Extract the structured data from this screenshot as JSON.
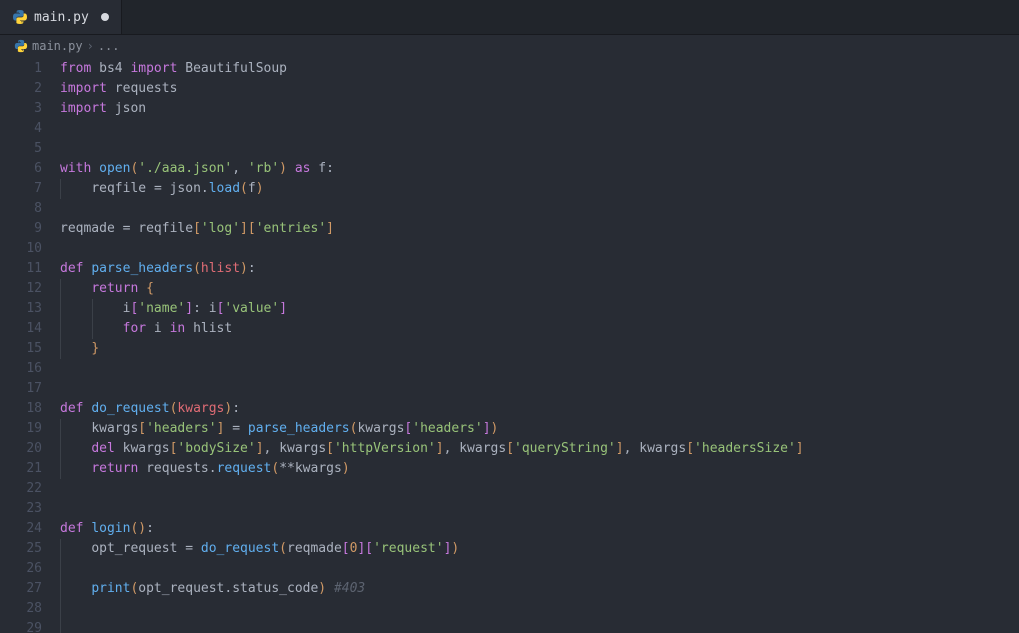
{
  "tab": {
    "filename": "main.py",
    "modified": true
  },
  "breadcrumb": {
    "filename": "main.py",
    "symbol": "..."
  },
  "line_count": 29,
  "code_lines": [
    {
      "n": 1,
      "indent": 0,
      "tokens": [
        [
          "kw",
          "from"
        ],
        [
          "pale",
          " bs4 "
        ],
        [
          "kw",
          "import"
        ],
        [
          "pale",
          " BeautifulSoup"
        ]
      ]
    },
    {
      "n": 2,
      "indent": 0,
      "tokens": [
        [
          "kw",
          "import"
        ],
        [
          "pale",
          " requests"
        ]
      ]
    },
    {
      "n": 3,
      "indent": 0,
      "tokens": [
        [
          "kw",
          "import"
        ],
        [
          "pale",
          " json"
        ]
      ]
    },
    {
      "n": 4,
      "indent": 0,
      "tokens": []
    },
    {
      "n": 5,
      "indent": 0,
      "tokens": []
    },
    {
      "n": 6,
      "indent": 0,
      "tokens": [
        [
          "kw",
          "with"
        ],
        [
          "pale",
          " "
        ],
        [
          "fn",
          "open"
        ],
        [
          "paren",
          "("
        ],
        [
          "str",
          "'./aaa.json'"
        ],
        [
          "pun",
          ", "
        ],
        [
          "str",
          "'rb'"
        ],
        [
          "paren",
          ")"
        ],
        [
          "pale",
          " "
        ],
        [
          "kw",
          "as"
        ],
        [
          "pale",
          " f"
        ],
        [
          "pun",
          ":"
        ]
      ]
    },
    {
      "n": 7,
      "indent": 1,
      "tokens": [
        [
          "pale",
          "reqfile "
        ],
        [
          "op",
          "="
        ],
        [
          "pale",
          " json"
        ],
        [
          "pun",
          "."
        ],
        [
          "fn",
          "load"
        ],
        [
          "paren",
          "("
        ],
        [
          "pale",
          "f"
        ],
        [
          "paren",
          ")"
        ]
      ]
    },
    {
      "n": 8,
      "indent": 0,
      "tokens": []
    },
    {
      "n": 9,
      "indent": 0,
      "tokens": [
        [
          "pale",
          "reqmade "
        ],
        [
          "op",
          "="
        ],
        [
          "pale",
          " reqfile"
        ],
        [
          "brack",
          "["
        ],
        [
          "str",
          "'log'"
        ],
        [
          "brack",
          "]["
        ],
        [
          "str",
          "'entries'"
        ],
        [
          "brack",
          "]"
        ]
      ]
    },
    {
      "n": 10,
      "indent": 0,
      "tokens": []
    },
    {
      "n": 11,
      "indent": 0,
      "tokens": [
        [
          "kw",
          "def"
        ],
        [
          "pale",
          " "
        ],
        [
          "fn-def",
          "parse_headers"
        ],
        [
          "paren",
          "("
        ],
        [
          "var",
          "hlist"
        ],
        [
          "paren",
          ")"
        ],
        [
          "pun",
          ":"
        ]
      ]
    },
    {
      "n": 12,
      "indent": 1,
      "tokens": [
        [
          "kw",
          "return"
        ],
        [
          "pale",
          " "
        ],
        [
          "paren",
          "{"
        ]
      ]
    },
    {
      "n": 13,
      "indent": 2,
      "tokens": [
        [
          "pale",
          "i"
        ],
        [
          "paren2",
          "["
        ],
        [
          "str",
          "'name'"
        ],
        [
          "paren2",
          "]"
        ],
        [
          "pun",
          ": "
        ],
        [
          "pale",
          "i"
        ],
        [
          "paren2",
          "["
        ],
        [
          "str",
          "'value'"
        ],
        [
          "paren2",
          "]"
        ]
      ]
    },
    {
      "n": 14,
      "indent": 2,
      "tokens": [
        [
          "kw",
          "for"
        ],
        [
          "pale",
          " i "
        ],
        [
          "kw",
          "in"
        ],
        [
          "pale",
          " hlist"
        ]
      ]
    },
    {
      "n": 15,
      "indent": 1,
      "tokens": [
        [
          "paren",
          "}"
        ]
      ]
    },
    {
      "n": 16,
      "indent": 0,
      "tokens": []
    },
    {
      "n": 17,
      "indent": 0,
      "tokens": []
    },
    {
      "n": 18,
      "indent": 0,
      "tokens": [
        [
          "kw",
          "def"
        ],
        [
          "pale",
          " "
        ],
        [
          "fn-def",
          "do_request"
        ],
        [
          "paren",
          "("
        ],
        [
          "var",
          "kwargs"
        ],
        [
          "paren",
          ")"
        ],
        [
          "pun",
          ":"
        ]
      ]
    },
    {
      "n": 19,
      "indent": 1,
      "tokens": [
        [
          "pale",
          "kwargs"
        ],
        [
          "paren",
          "["
        ],
        [
          "str",
          "'headers'"
        ],
        [
          "paren",
          "]"
        ],
        [
          "pale",
          " "
        ],
        [
          "op",
          "="
        ],
        [
          "pale",
          " "
        ],
        [
          "fn",
          "parse_headers"
        ],
        [
          "paren",
          "("
        ],
        [
          "pale",
          "kwargs"
        ],
        [
          "paren2",
          "["
        ],
        [
          "str",
          "'headers'"
        ],
        [
          "paren2",
          "]"
        ],
        [
          "paren",
          ")"
        ]
      ]
    },
    {
      "n": 20,
      "indent": 1,
      "tokens": [
        [
          "kw",
          "del"
        ],
        [
          "pale",
          " kwargs"
        ],
        [
          "paren",
          "["
        ],
        [
          "str",
          "'bodySize'"
        ],
        [
          "paren",
          "]"
        ],
        [
          "pun",
          ", "
        ],
        [
          "pale",
          "kwargs"
        ],
        [
          "paren",
          "["
        ],
        [
          "str",
          "'httpVersion'"
        ],
        [
          "paren",
          "]"
        ],
        [
          "pun",
          ", "
        ],
        [
          "pale",
          "kwargs"
        ],
        [
          "paren",
          "["
        ],
        [
          "str",
          "'queryString'"
        ],
        [
          "paren",
          "]"
        ],
        [
          "pun",
          ", "
        ],
        [
          "pale",
          "kwargs"
        ],
        [
          "paren",
          "["
        ],
        [
          "str",
          "'headersSize'"
        ],
        [
          "paren",
          "]"
        ]
      ]
    },
    {
      "n": 21,
      "indent": 1,
      "tokens": [
        [
          "kw",
          "return"
        ],
        [
          "pale",
          " requests"
        ],
        [
          "pun",
          "."
        ],
        [
          "fn",
          "request"
        ],
        [
          "paren",
          "("
        ],
        [
          "op",
          "**"
        ],
        [
          "pale",
          "kwargs"
        ],
        [
          "paren",
          ")"
        ]
      ]
    },
    {
      "n": 22,
      "indent": 0,
      "tokens": []
    },
    {
      "n": 23,
      "indent": 0,
      "tokens": []
    },
    {
      "n": 24,
      "indent": 0,
      "tokens": [
        [
          "kw",
          "def"
        ],
        [
          "pale",
          " "
        ],
        [
          "fn-def",
          "login"
        ],
        [
          "paren",
          "()"
        ],
        [
          "pun",
          ":"
        ]
      ]
    },
    {
      "n": 25,
      "indent": 1,
      "tokens": [
        [
          "pale",
          "opt_request "
        ],
        [
          "op",
          "="
        ],
        [
          "pale",
          " "
        ],
        [
          "fn",
          "do_request"
        ],
        [
          "paren",
          "("
        ],
        [
          "pale",
          "reqmade"
        ],
        [
          "paren2",
          "["
        ],
        [
          "num",
          "0"
        ],
        [
          "paren2",
          "]["
        ],
        [
          "str",
          "'request'"
        ],
        [
          "paren2",
          "]"
        ],
        [
          "paren",
          ")"
        ]
      ]
    },
    {
      "n": 26,
      "indent": 1,
      "tokens": []
    },
    {
      "n": 27,
      "indent": 1,
      "tokens": [
        [
          "fn",
          "print"
        ],
        [
          "paren",
          "("
        ],
        [
          "pale",
          "opt_request"
        ],
        [
          "pun",
          "."
        ],
        [
          "pale",
          "status_code"
        ],
        [
          "paren",
          ")"
        ],
        [
          "pale",
          " "
        ],
        [
          "comment",
          "#403"
        ]
      ]
    },
    {
      "n": 28,
      "indent": 1,
      "tokens": []
    },
    {
      "n": 29,
      "indent": 1,
      "tokens": []
    }
  ]
}
